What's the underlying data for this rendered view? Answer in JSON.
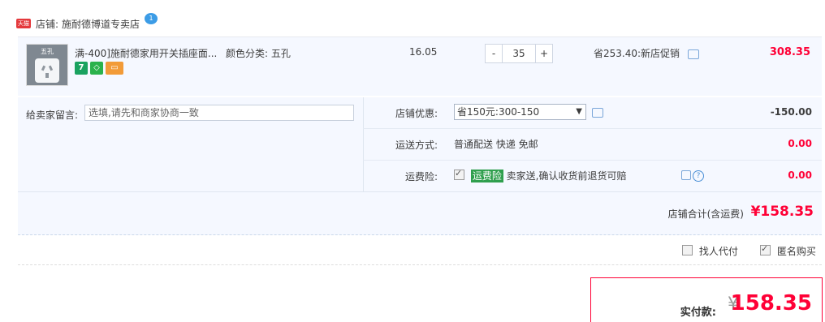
{
  "shop": {
    "badge": "天猫",
    "prefix": "店铺:",
    "name": "施耐德博道专卖店",
    "chat_badge": "1"
  },
  "item": {
    "thumbnail_label": "五孔",
    "title": "满-400]施耐德家用开关插座面...",
    "color_label": "颜色分类:",
    "color_value": "五孔",
    "unit_price": "16.05",
    "quantity": "35",
    "promo": "省253.40:新店促销",
    "subtotal": "308.35",
    "tag_icons": [
      "seven-day-return-icon",
      "shield-icon",
      "card-icon"
    ]
  },
  "message": {
    "label": "给卖家留言:",
    "placeholder": "选填,请先和商家协商一致"
  },
  "discount": {
    "label": "店铺优惠:",
    "selected": "省150元:300-150",
    "amount": "-150.00"
  },
  "shipping": {
    "label": "运送方式:",
    "value": "普通配送 快递 免邮",
    "amount": "0.00"
  },
  "insurance": {
    "label": "运费险:",
    "chip": "运费险",
    "text": "卖家送,确认收货前退货可赔",
    "amount": "0.00"
  },
  "totals": {
    "label": "店铺合计(含运费)",
    "value": "¥158.35"
  },
  "options": {
    "proxy_pay": "找人代付",
    "anonymous": "匿名购买"
  },
  "pay": {
    "label": "实付款:",
    "currency": "¥",
    "value": "158.35"
  },
  "colors": {
    "accent": "#ff0036",
    "panel_bg": "#f5f8ff",
    "chip_green": "#2f9f4d"
  }
}
